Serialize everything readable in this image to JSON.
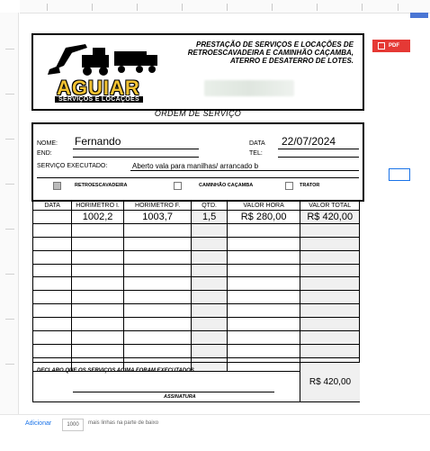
{
  "company": {
    "brand_name": "AGUIAR",
    "brand_sub": "SERVIÇOS E LOCAÇÕES",
    "services_text": "PRESTAÇÃO DE SERVIÇOS E LOCAÇÕES DE RETROESCAVADEIRA E CAMINHÃO CAÇAMBA, ATERRO E DESATERRO DE LOTES."
  },
  "form_title": "ORDEM DE SERVIÇO",
  "client": {
    "nome_label": "NOME:",
    "nome_value": "Fernando",
    "end_label": "END:",
    "data_label": "DATA",
    "data_value": "22/07/2024",
    "tel_label": "TEL:",
    "servico_label": "SERVIÇO EXECUTADO:",
    "servico_value": "Aberto vala para manilhas/ arrancado b"
  },
  "equipment": [
    {
      "label": "RETROESCAVADEIRA",
      "checked": true
    },
    {
      "label": "CAMINHÃO CAÇAMBA",
      "checked": false
    },
    {
      "label": "TRATOR",
      "checked": false
    }
  ],
  "table": {
    "headers": [
      "DATA",
      "HORIMETRO I.",
      "HORIMETRO F.",
      "QTD.",
      "VALOR HORA",
      "VALOR TOTAL"
    ],
    "rows": [
      [
        "",
        "1002,2",
        "1003,7",
        "1,5",
        "R$ 280,00",
        "R$ 420,00"
      ],
      [
        "",
        "",
        "",
        "",
        "",
        ""
      ],
      [
        "",
        "",
        "",
        "",
        "",
        ""
      ],
      [
        "",
        "",
        "",
        "",
        "",
        ""
      ],
      [
        "",
        "",
        "",
        "",
        "",
        ""
      ],
      [
        "",
        "",
        "",
        "",
        "",
        ""
      ],
      [
        "",
        "",
        "",
        "",
        "",
        ""
      ],
      [
        "",
        "",
        "",
        "",
        "",
        ""
      ],
      [
        "",
        "",
        "",
        "",
        "",
        ""
      ],
      [
        "",
        "",
        "",
        "",
        "",
        ""
      ],
      [
        "",
        "",
        "",
        "",
        "",
        ""
      ],
      [
        "",
        "",
        "",
        "",
        "",
        ""
      ]
    ]
  },
  "footer": {
    "declaro": "DECLARO QUE OS SERVIÇOS ACIMA FORAM EXECUTADOS.",
    "assinatura": "ASSINATURA",
    "total": "R$ 420,00"
  },
  "pdf_button": "PDF",
  "addbar": {
    "add_label": "Adicionar",
    "rows_count": "1000",
    "suffix_text": "mais linhas na parte de baixo"
  },
  "colors": {
    "brand_yellow": "#f1c232",
    "pdf_red": "#e53935",
    "link_blue": "#1a73e8"
  }
}
